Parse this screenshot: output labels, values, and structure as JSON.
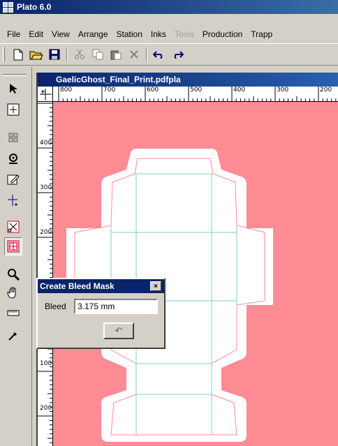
{
  "app": {
    "title": "Plato 6.0"
  },
  "menu": [
    "File",
    "Edit",
    "View",
    "Arrange",
    "Station",
    "Inks",
    "Tools",
    "Production",
    "Trapp"
  ],
  "menu_disabled": [
    "Tools"
  ],
  "toolbar": {
    "buttons": [
      "new-document",
      "open-folder",
      "save",
      "cut",
      "copy",
      "paste",
      "delete",
      "undo",
      "redo"
    ]
  },
  "tools": [
    "select-arrow",
    "move-to-center",
    "grid",
    "target",
    "edit-path",
    "mark-position",
    "trim-marks",
    "bleed-mask",
    "zoom",
    "hand",
    "ruler",
    "eyedropper"
  ],
  "document": {
    "title": "GaelicGhost_Final_Print.pdfpla",
    "ruler_h": [
      "800",
      "700",
      "600",
      "500",
      "400",
      "300",
      "200"
    ],
    "ruler_v": [
      "400",
      "300",
      "200",
      "100",
      "100",
      "200"
    ]
  },
  "dialog": {
    "title": "Create Bleed Mask",
    "close": "×",
    "bleed_label": "Bleed",
    "bleed_value": "3.175 mm",
    "apply_glyph": "↶"
  },
  "colors": {
    "canvas": "#ff8b95",
    "dieline": "#7fcfc0",
    "title": "#0a246a"
  }
}
